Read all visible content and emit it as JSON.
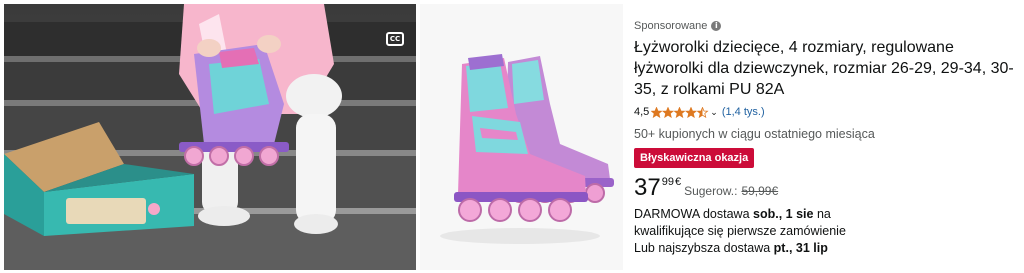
{
  "video": {
    "cc_label": "CC"
  },
  "product": {
    "sponsored_label": "Sponsorowane",
    "title": "Łyżworolki dziecięce, 4 rozmiary, regulowane łyżworolki dla dziewczynek, rozmiar 26-29, 29-34, 30-35, z rolkami PU 82A",
    "rating_value": "4,5",
    "rating_stars": 4.5,
    "rating_count": "(1,4 tys.)",
    "bought_text": "50+ kupionych w ciągu ostatniego miesiąca",
    "deal_badge": "Błyskawiczna okazja",
    "price_whole": "37",
    "price_fraction": "99",
    "price_currency": "€",
    "suggested_label": "Sugerow.:",
    "suggested_price": "59,99€",
    "delivery_prefix": "DARMOWA dostawa ",
    "delivery_date": "sob., 1 sie",
    "delivery_suffix": " na",
    "delivery_line2": "kwalifikujące się pierwsze zamówienie",
    "fastest_prefix": "Lub najszybsza dostawa ",
    "fastest_date": "pt., 31 lip"
  },
  "colors": {
    "deal_red": "#cc0c39",
    "star_orange": "#de7921",
    "link_blue": "#2162a1"
  }
}
